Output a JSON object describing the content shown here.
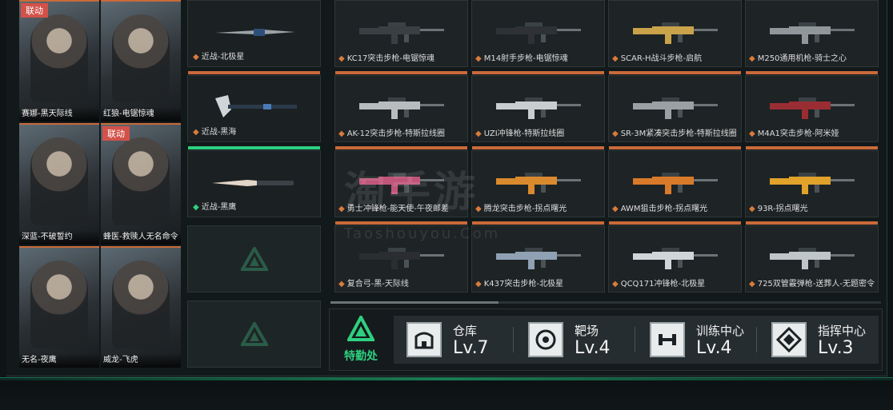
{
  "operators": [
    {
      "label": "赛娜-黑天际线",
      "tag": "联动"
    },
    {
      "label": "红狼-电锯惊魂",
      "tag": ""
    },
    {
      "label": "深蓝-不破誓约",
      "tag": ""
    },
    {
      "label": "蜂医-救赎人无名命令",
      "tag": "联动"
    },
    {
      "label": "无名-夜鹰",
      "tag": ""
    },
    {
      "label": "威龙-飞虎",
      "tag": ""
    }
  ],
  "melee": [
    {
      "label": "近战-北极星"
    },
    {
      "label": "近战-黑海"
    },
    {
      "label": "近战-黑鹰"
    }
  ],
  "weapons": [
    {
      "label": "KC17突击步枪-电锯惊魂"
    },
    {
      "label": "M14射手步枪-电锯惊魂"
    },
    {
      "label": "SCAR-H战斗步枪-启航"
    },
    {
      "label": "M250通用机枪-骑士之心"
    },
    {
      "label": "AK-12突击步枪-特斯拉线圈"
    },
    {
      "label": "UZI冲锋枪-特斯拉线圈"
    },
    {
      "label": "SR-3M紧凑突击步枪-特斯拉线圈"
    },
    {
      "label": "M4A1突击步枪-阿米娅"
    },
    {
      "label": "勇士冲锋枪-能天使-午夜邮差"
    },
    {
      "label": "腾龙突击步枪-拐点曙光"
    },
    {
      "label": "AWM狙击步枪-拐点曙光"
    },
    {
      "label": "93R-拐点曙光"
    },
    {
      "label": "复合弓-黑-天际线"
    },
    {
      "label": "K437突击步枪-北极星"
    },
    {
      "label": "QCQ171冲锋枪-北极星"
    },
    {
      "label": "725双管霰弹枪-送葬人-无题密令"
    }
  ],
  "watermark": {
    "main": "淘手游",
    "sub": "Taoshouyou.Com"
  },
  "facilities": {
    "title": "特勤处",
    "items": [
      {
        "name": "仓库",
        "level": "Lv.7",
        "icon": "warehouse-icon"
      },
      {
        "name": "靶场",
        "level": "Lv.4",
        "icon": "target-icon"
      },
      {
        "name": "训练中心",
        "level": "Lv.4",
        "icon": "dumbbell-icon"
      },
      {
        "name": "指挥中心",
        "level": "Lv.3",
        "icon": "command-icon"
      }
    ]
  },
  "colors": {
    "accent_orange": "#c96a3a",
    "accent_green": "#2ed07f",
    "link_tag": "#d2524a"
  }
}
